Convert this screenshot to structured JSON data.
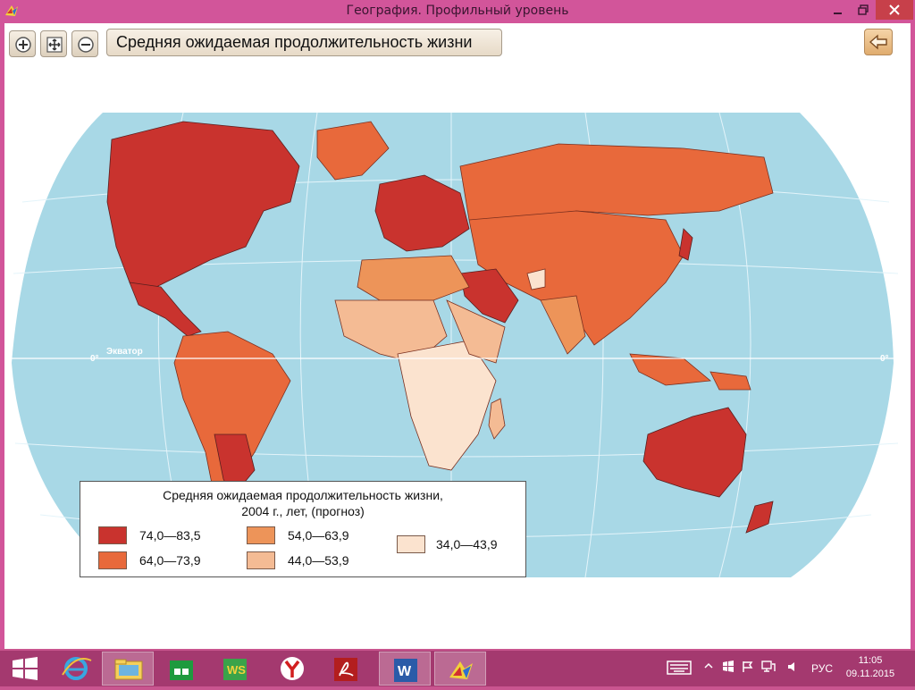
{
  "window": {
    "title": "География. Профильный уровень",
    "minimize_icon": "minimize-icon",
    "maximize_icon": "restore-icon",
    "close_icon": "close-icon"
  },
  "toolbar": {
    "zoom_in_icon": "zoom-in-icon",
    "pan_icon": "pan-move-icon",
    "zoom_out_icon": "zoom-out-icon",
    "map_title": "Средняя ожидаемая продолжительность жизни",
    "back_icon": "back-arrow-icon"
  },
  "map": {
    "equator_label": "Экватор",
    "degree_left": "0°",
    "degree_right": "0°",
    "colors": {
      "ocean": "#a8d8e6",
      "c1": "#c9332e",
      "c2": "#e8693b",
      "c3": "#ed9459",
      "c4": "#f4bb94",
      "c5": "#fbe3cf"
    }
  },
  "legend": {
    "title_line1": "Средняя ожидаемая продолжительность жизни,",
    "title_line2": "2004 г., лет, (прогноз)",
    "items": [
      {
        "label": "74,0—83,5",
        "color": "#c9332e"
      },
      {
        "label": "64,0—73,9",
        "color": "#e8693b"
      },
      {
        "label": "54,0—63,9",
        "color": "#ed9459"
      },
      {
        "label": "44,0—53,9",
        "color": "#f4bb94"
      },
      {
        "label": "34,0—43,9",
        "color": "#fbe3cf"
      }
    ]
  },
  "taskbar": {
    "apps": [
      "start-icon",
      "internet-explorer-icon",
      "file-explorer-icon",
      "store-icon",
      "ws-app-icon",
      "yandex-browser-icon",
      "pdf-reader-icon",
      "word-icon",
      "geography-app-icon"
    ],
    "language": "РУС",
    "time": "11:05",
    "date": "09.11.2015"
  }
}
